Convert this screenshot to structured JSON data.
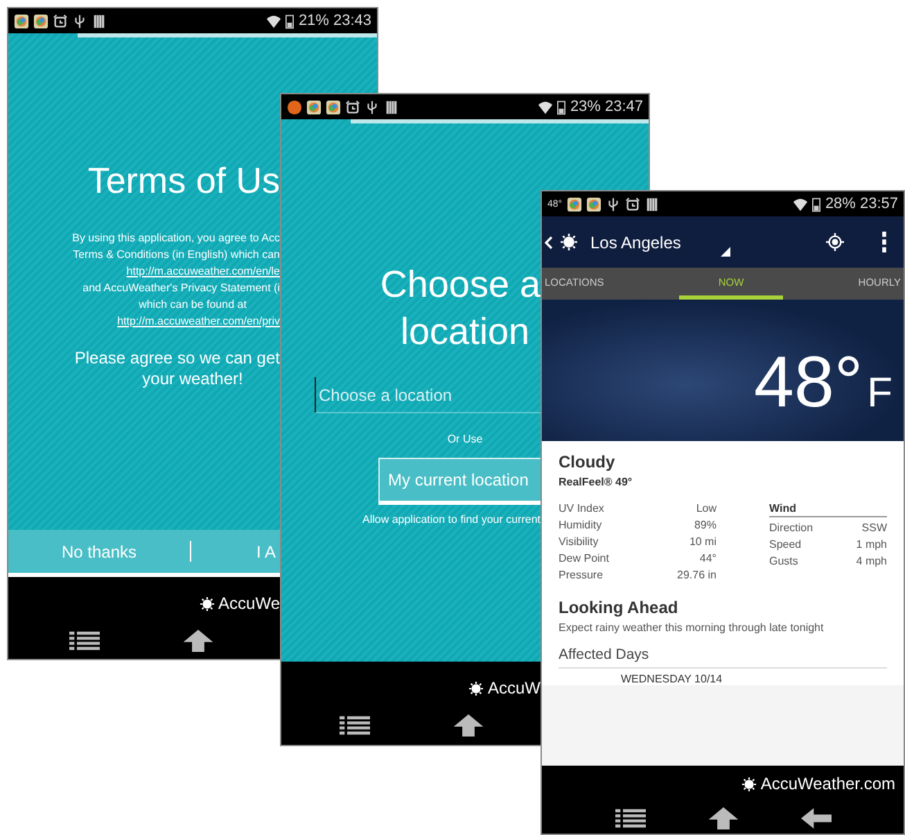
{
  "terms_screen": {
    "status": {
      "battery": "21%",
      "time": "23:43"
    },
    "title": "Terms of Us",
    "paragraph": [
      {
        "text": "By using this application, you agree to Acc",
        "cut": true,
        "link": false
      },
      {
        "text": "Terms & Conditions (in English) which can",
        "cut": true,
        "link": false
      },
      {
        "text": "http://m.accuweather.com/en/le",
        "cut": true,
        "link": true
      },
      {
        "text": "and AccuWeather's Privacy Statement (i",
        "cut": true,
        "link": false
      },
      {
        "text": "which can be found at",
        "cut": false,
        "link": false
      },
      {
        "text": "http://m.accuweather.com/en/priv",
        "cut": true,
        "link": true
      }
    ],
    "prompt": [
      {
        "text": "Please agree so we can get",
        "cut": true
      },
      {
        "text": "your weather!",
        "cut": false
      }
    ],
    "buttons": [
      "No thanks",
      "I A"
    ],
    "brand": "AccuWe"
  },
  "location_screen": {
    "status": {
      "battery": "23%",
      "time": "23:47"
    },
    "title": [
      "Choose a",
      "location"
    ],
    "search": {
      "placeholder": "Choose a location"
    },
    "or_label": "Or Use",
    "current_location_button": "My current location",
    "hint": "Allow application to find your current",
    "brand": "AccuW"
  },
  "weather_screen": {
    "status": {
      "temperature": "48°",
      "battery": "28%",
      "time": "23:57"
    },
    "city": "Los Angeles",
    "tabs": [
      {
        "label": "LOCATIONS",
        "selected": false
      },
      {
        "label": "NOW",
        "selected": true
      },
      {
        "label": "HOURLY",
        "selected": false
      }
    ],
    "temperature": "48°",
    "unit": "F",
    "condition": "Cloudy",
    "realfeel": "RealFeel® 49°",
    "details": [
      {
        "label": "UV Index",
        "value": "Low"
      },
      {
        "label": "Humidity",
        "value": "89%"
      },
      {
        "label": "Visibility",
        "value": "10 mi"
      },
      {
        "label": "Dew Point",
        "value": "44°"
      },
      {
        "label": "Pressure",
        "value": "29.76 in"
      }
    ],
    "wind": {
      "title": "Wind",
      "rows": [
        {
          "label": "Direction",
          "value": "SSW"
        },
        {
          "label": "Speed",
          "value": "1 mph"
        },
        {
          "label": "Gusts",
          "value": "4 mph"
        }
      ]
    },
    "looking_ahead": {
      "title": "Looking Ahead",
      "text": "Expect rainy weather this morning through late tonight"
    },
    "affected_days": {
      "title": "Affected Days",
      "days": [
        "WEDNESDAY 10/14"
      ]
    },
    "brand": "AccuWeather.com"
  }
}
